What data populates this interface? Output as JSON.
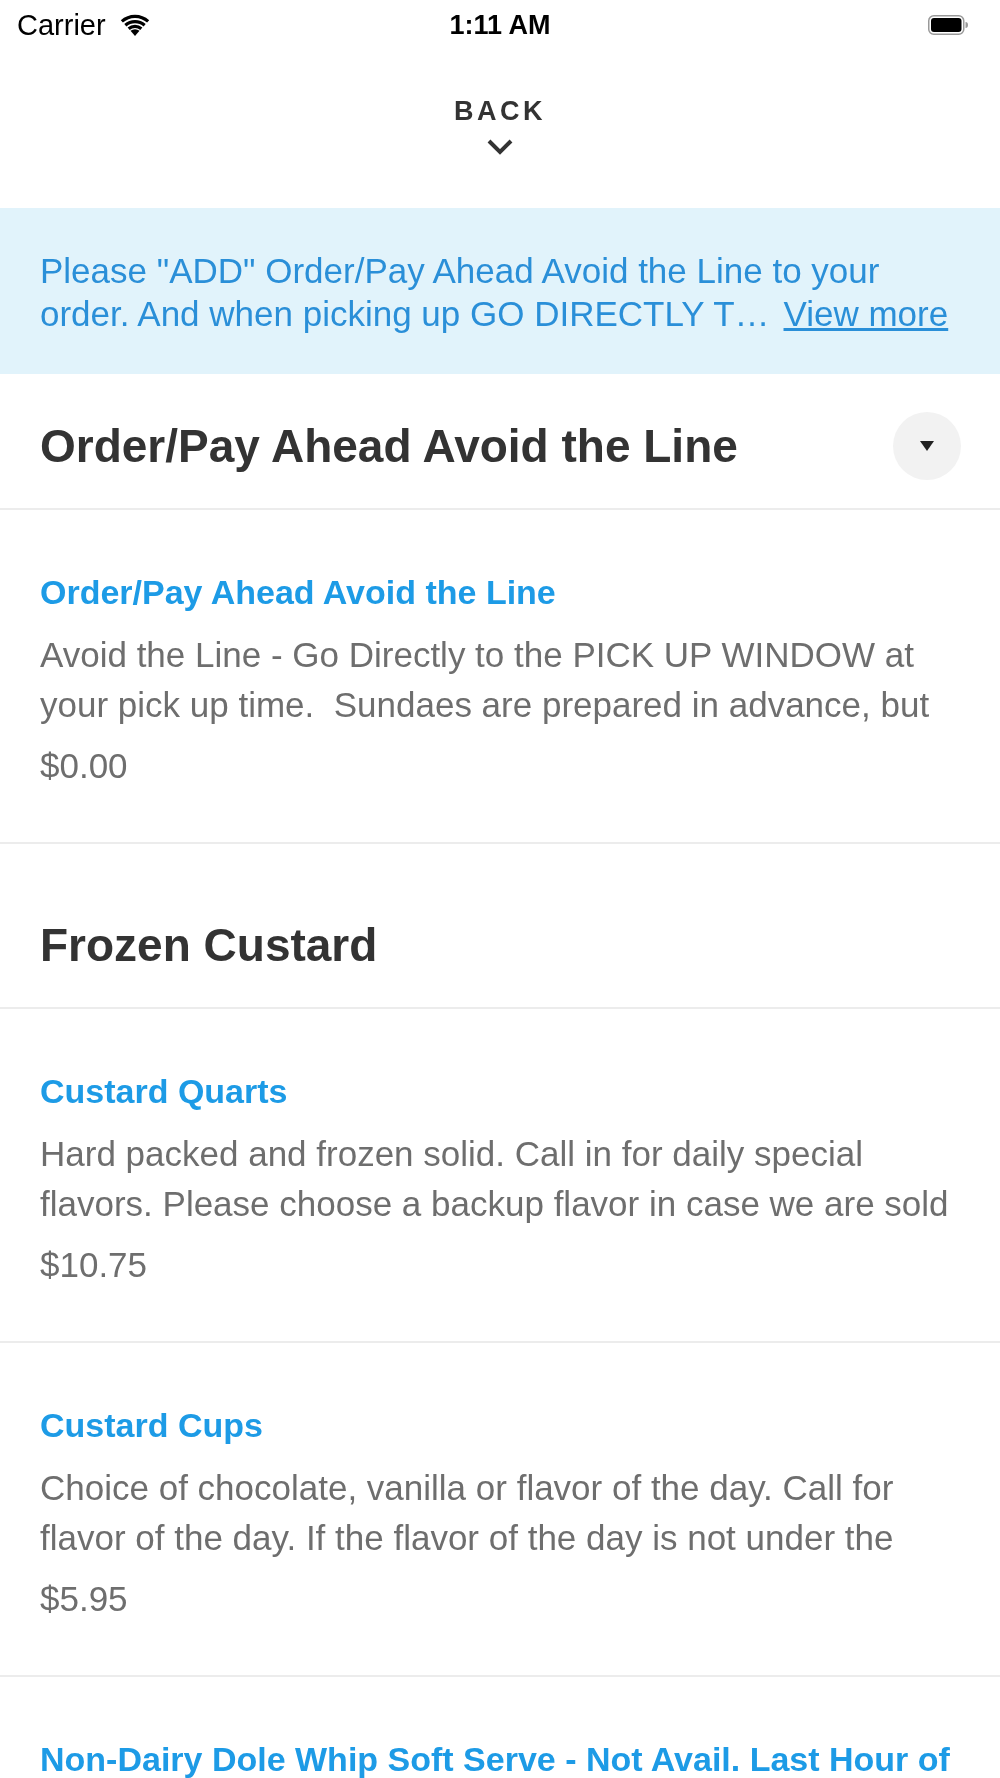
{
  "status_bar": {
    "carrier": "Carrier",
    "time": "1:11 AM"
  },
  "back": {
    "label": "BACK"
  },
  "notice": {
    "text": "Please \"ADD\" Order/Pay Ahead Avoid the Line to your\norder. And when picking up GO DIRECTLY T…",
    "link": "View more"
  },
  "sections": [
    {
      "title": "Order/Pay Ahead Avoid the Line",
      "toggle": true,
      "items": [
        {
          "name": "Order/Pay Ahead Avoid the Line",
          "description": "Avoid the Line - Go Directly to the PICK UP WINDOW at\nyour pick up time.  Sundaes are prepared in advance, but",
          "price": "$0.00"
        }
      ]
    },
    {
      "title": "Frozen Custard",
      "toggle": false,
      "items": [
        {
          "name": "Custard Quarts",
          "description": "Hard packed and frozen solid. Call in for daily special\nflavors. Please choose a backup flavor in case we are sold",
          "price": "$10.75"
        },
        {
          "name": "Custard Cups",
          "description": "Choice of chocolate, vanilla or flavor of the day. Call for\nflavor of the day. If the flavor of the day is not under the",
          "price": "$5.95"
        },
        {
          "name": "Non-Dairy Dole Whip Soft Serve - Not Avail. Last Hour of"
        }
      ]
    }
  ]
}
